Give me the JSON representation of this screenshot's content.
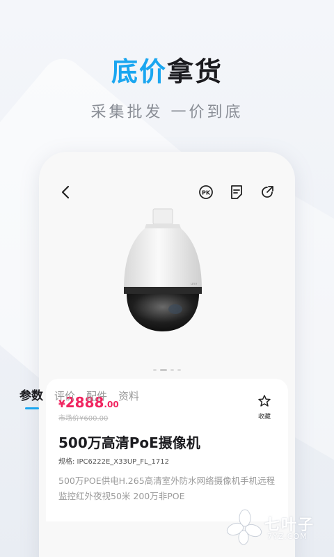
{
  "promo": {
    "headline_part1": "底价",
    "headline_part2": "拿货",
    "subheadline": "采集批发 一价到底"
  },
  "product": {
    "price_currency": "¥",
    "price_integer": "2888",
    "price_decimal": ".00",
    "market_price": "市场价¥600.00",
    "favorite_label": "收藏",
    "title": "500万高清PoE摄像机",
    "spec": "规格: IPC6222E_X33UP_FL_1712",
    "description": "500万POE供电H.265高清室外防水网络摄像机手机远程监控红外夜视50米 200万非POE"
  },
  "carousel": {
    "count": 4,
    "active_index": 1
  },
  "tabs": [
    {
      "label": "参数",
      "active": true
    },
    {
      "label": "评价",
      "active": false
    },
    {
      "label": "配件",
      "active": false
    },
    {
      "label": "资料",
      "active": false
    }
  ],
  "watermark": {
    "name": "七叶子",
    "url": "7YZ.COM"
  },
  "colors": {
    "accent": "#1aa6f0",
    "price": "#f0245f",
    "title": "#1b1b1f"
  },
  "icons": [
    "back-arrow-icon",
    "pk-icon",
    "note-icon",
    "share-icon",
    "star-icon"
  ]
}
